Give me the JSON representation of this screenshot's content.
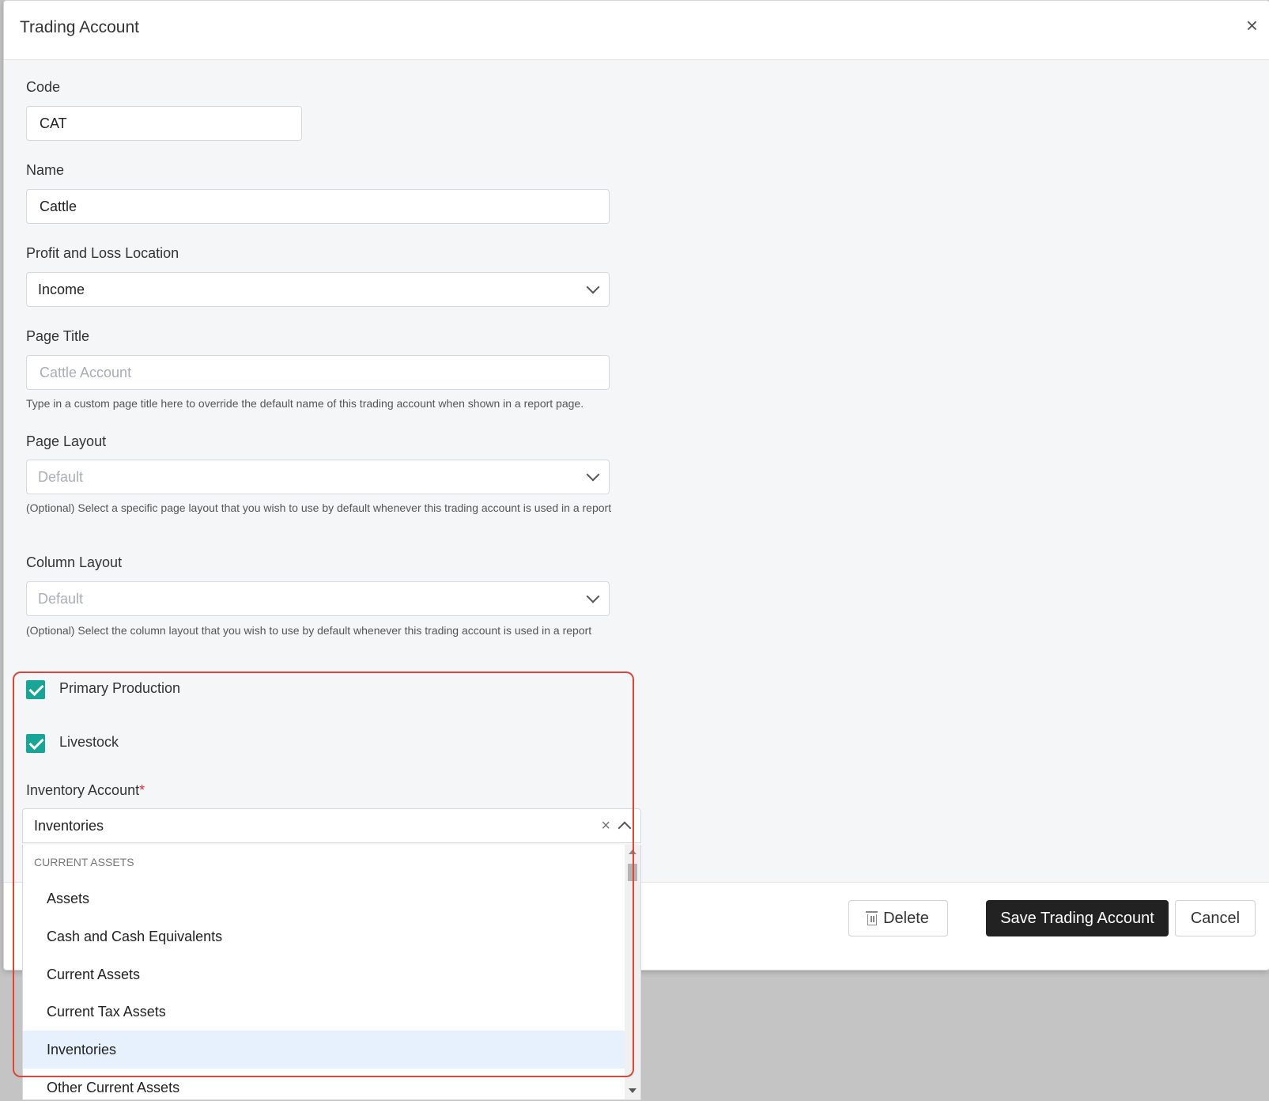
{
  "modal": {
    "title": "Trading Account",
    "close_icon": "close-icon"
  },
  "form": {
    "code": {
      "label": "Code",
      "value": "CAT"
    },
    "name": {
      "label": "Name",
      "value": "Cattle"
    },
    "pl_location": {
      "label": "Profit and Loss Location",
      "value": "Income"
    },
    "page_title": {
      "label": "Page Title",
      "placeholder": "Cattle Account",
      "hint": "Type in a custom page title here to override the default name of this trading account when shown in a report page."
    },
    "page_layout": {
      "label": "Page Layout",
      "placeholder": "Default",
      "hint": "(Optional) Select a specific page layout that you wish to use by default whenever this trading account is used in a report"
    },
    "column_layout": {
      "label": "Column Layout",
      "placeholder": "Default",
      "hint": "(Optional) Select the column layout that you wish to use by default whenever this trading account is used in a report"
    },
    "primary_production": {
      "label": "Primary Production",
      "checked": true
    },
    "livestock": {
      "label": "Livestock",
      "checked": true
    },
    "inventory_account": {
      "label": "Inventory Account",
      "required_mark": "*",
      "value": "Inventories"
    }
  },
  "dropdown": {
    "group": "CURRENT ASSETS",
    "options": [
      "Assets",
      "Cash and Cash Equivalents",
      "Current Assets",
      "Current Tax Assets",
      "Inventories",
      "Other Current Assets"
    ],
    "selected": "Inventories"
  },
  "footer": {
    "delete_label": "Delete",
    "save_label": "Save Trading Account",
    "cancel_label": "Cancel"
  },
  "colors": {
    "accent_checkbox": "#16a596",
    "save_button": "#222222",
    "highlight_border": "#d9473c",
    "selected_option": "#e6f1fd"
  }
}
